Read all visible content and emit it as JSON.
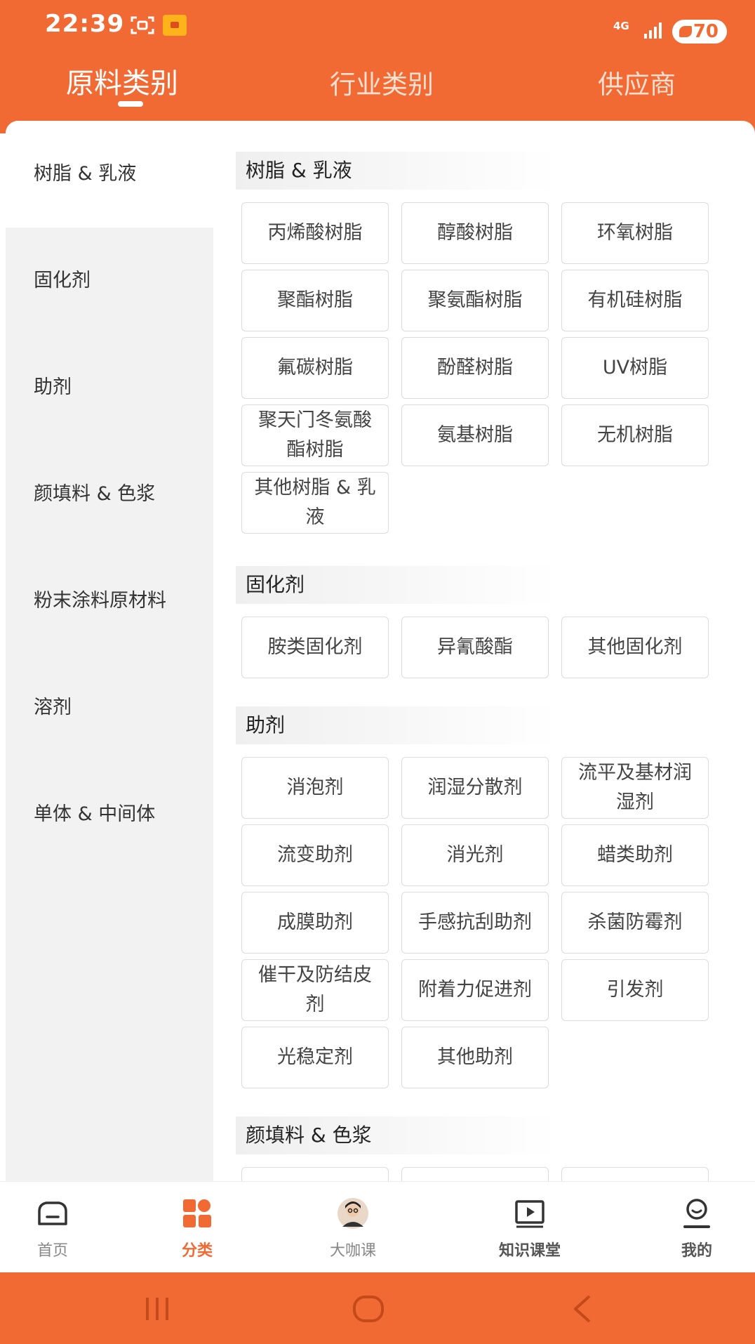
{
  "status_bar": {
    "time": "22:39",
    "network": "4G",
    "battery": "70"
  },
  "top_tabs": [
    {
      "label": "原料类别",
      "active": true
    },
    {
      "label": "行业类别",
      "active": false
    },
    {
      "label": "供应商",
      "active": false
    }
  ],
  "sidebar": {
    "items": [
      {
        "label": "树脂 & 乳液",
        "active": true
      },
      {
        "label": "固化剂",
        "active": false
      },
      {
        "label": "助剂",
        "active": false
      },
      {
        "label": "颜填料 & 色浆",
        "active": false
      },
      {
        "label": "粉末涂料原材料",
        "active": false
      },
      {
        "label": "溶剂",
        "active": false
      },
      {
        "label": "单体 & 中间体",
        "active": false
      }
    ]
  },
  "sections": [
    {
      "title": "树脂 & 乳液",
      "chips": [
        "丙烯酸树脂",
        "醇酸树脂",
        "环氧树脂",
        "聚酯树脂",
        "聚氨酯树脂",
        "有机硅树脂",
        "氟碳树脂",
        "酚醛树脂",
        "UV树脂",
        "聚天门冬氨酸酯树脂",
        "氨基树脂",
        "无机树脂",
        "其他树脂 & 乳液"
      ]
    },
    {
      "title": "固化剂",
      "chips": [
        "胺类固化剂",
        "异氰酸酯",
        "其他固化剂"
      ]
    },
    {
      "title": "助剂",
      "chips": [
        "消泡剂",
        "润湿分散剂",
        "流平及基材润湿剂",
        "流变助剂",
        "消光剂",
        "蜡类助剂",
        "成膜助剂",
        "手感抗刮助剂",
        "杀菌防霉剂",
        "催干及防结皮剂",
        "附着力促进剂",
        "引发剂",
        "光稳定剂",
        "其他助剂"
      ]
    },
    {
      "title": "颜填料 & 色浆",
      "chips": []
    }
  ],
  "bottom_nav": [
    {
      "label": "首页",
      "icon": "home-icon",
      "active": false
    },
    {
      "label": "分类",
      "icon": "category-icon",
      "active": true
    },
    {
      "label": "大咖课",
      "icon": "expert-avatar-icon",
      "active": false
    },
    {
      "label": "知识课堂",
      "icon": "video-play-icon",
      "active": false
    },
    {
      "label": "我的",
      "icon": "profile-icon",
      "active": false
    }
  ],
  "colors": {
    "brand": "#f26a33",
    "sidebar_bg": "#f2f2f2",
    "chip_border": "#dcdcdc"
  }
}
